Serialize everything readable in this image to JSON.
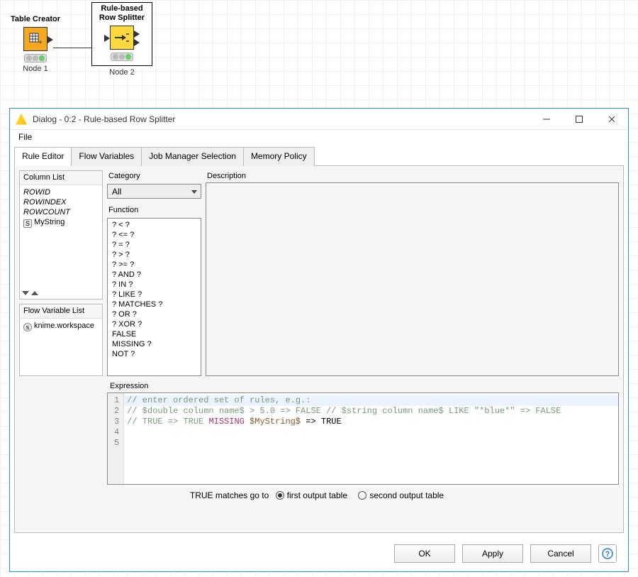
{
  "canvas": {
    "node1": {
      "label": "Table Creator",
      "id": "Node 1"
    },
    "node2": {
      "label": "Rule-based Row Splitter",
      "id": "Node 2"
    }
  },
  "dialog": {
    "title": "Dialog - 0:2 - Rule-based Row Splitter",
    "menu_file": "File",
    "tabs": [
      "Rule Editor",
      "Flow Variables",
      "Job Manager Selection",
      "Memory Policy"
    ],
    "column_list": {
      "title": "Column List",
      "items": [
        "ROWID",
        "ROWINDEX",
        "ROWCOUNT"
      ],
      "col_name": "MyString"
    },
    "flow_var_list": {
      "title": "Flow Variable List",
      "item": "knime.workspace"
    },
    "category_label": "Category",
    "category_value": "All",
    "function_label": "Function",
    "functions": [
      "? < ?",
      "? <= ?",
      "? = ?",
      "? > ?",
      "? >= ?",
      "? AND ?",
      "? IN ?",
      "? LIKE ?",
      "? MATCHES ?",
      "? OR ?",
      "? XOR ?",
      "FALSE",
      "MISSING ?",
      "NOT ?"
    ],
    "description_label": "Description",
    "expression_label": "Expression",
    "expression_lines": {
      "l1": "// enter ordered set of rules, e.g.:",
      "l2": "// $double column name$ > 5.0 => FALSE",
      "l3": "// $string column name$ LIKE \"*blue*\" => FALSE",
      "l4": "// TRUE => TRUE",
      "l5_kw": "MISSING",
      "l5_var": " $MyString$ ",
      "l5_rest": "=> TRUE"
    },
    "radio_label": "TRUE matches go to",
    "radio_first": "first output table",
    "radio_second": "second output table",
    "buttons": {
      "ok": "OK",
      "apply": "Apply",
      "cancel": "Cancel"
    }
  }
}
